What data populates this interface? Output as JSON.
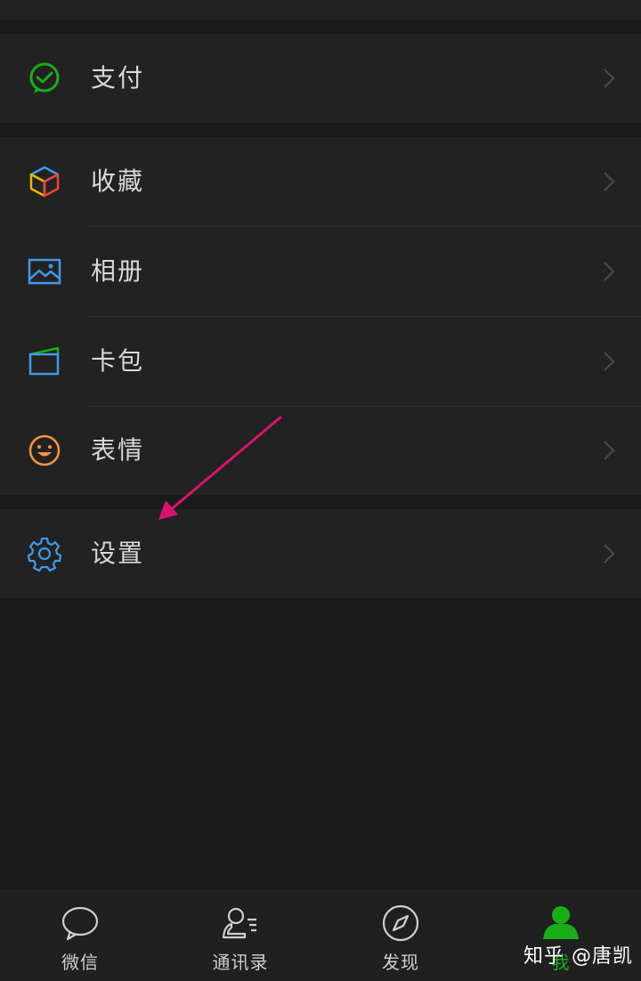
{
  "menu": {
    "pay": {
      "label": "支付",
      "icon": "wechat-pay-icon"
    },
    "favorites": {
      "label": "收藏",
      "icon": "favorites-cube-icon"
    },
    "album": {
      "label": "相册",
      "icon": "photo-album-icon"
    },
    "cards": {
      "label": "卡包",
      "icon": "card-wallet-icon"
    },
    "stickers": {
      "label": "表情",
      "icon": "smiley-face-icon"
    },
    "settings": {
      "label": "设置",
      "icon": "gear-icon"
    }
  },
  "tabbar": {
    "tabs": [
      {
        "label": "微信",
        "icon": "chat-bubble-icon",
        "active": false
      },
      {
        "label": "通讯录",
        "icon": "contacts-icon",
        "active": false
      },
      {
        "label": "发现",
        "icon": "compass-icon",
        "active": false
      },
      {
        "label": "我",
        "icon": "profile-icon",
        "active": true
      }
    ]
  },
  "watermark": "知乎 @唐凯",
  "colors": {
    "background": "#1a1a1a",
    "row_background": "#222222",
    "accent_green": "#1aad19",
    "annotation_arrow": "#d6146f"
  }
}
